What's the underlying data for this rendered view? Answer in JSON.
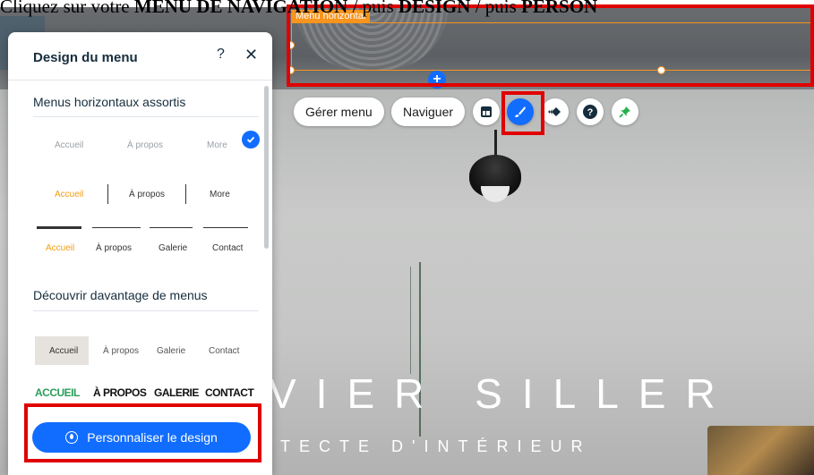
{
  "instruction": {
    "part1": "Cliquez sur votre ",
    "part2": "MENU DE NAVIGATION",
    "part3": " / puis ",
    "part4": "DESIGN",
    "part5": " / puis ",
    "part6": "PERSON"
  },
  "site": {
    "title": "VIER  SILLER",
    "subtitle": "ITECTE  D'INTÉRIEUR"
  },
  "editor": {
    "element_label": "Menu horizontal",
    "add_symbol": "+",
    "toolbar": {
      "manage_menu": "Gérer menu",
      "navigate": "Naviguer",
      "help_symbol": "?"
    }
  },
  "panel": {
    "title": "Design du menu",
    "help_symbol": "?",
    "close_symbol": "✕",
    "section1_title": "Menus horizontaux assortis",
    "section2_title": "Découvrir davantage de menus",
    "presets": [
      {
        "items": [
          "Accueil",
          "À propos",
          "More"
        ]
      },
      {
        "items": [
          "Accueil",
          "À propos",
          "More"
        ]
      },
      {
        "items": [
          "Accueil",
          "À propos",
          "Galerie",
          "Contact"
        ]
      },
      {
        "items": [
          "Accueil",
          "À propos",
          "Galerie",
          "Contact"
        ]
      },
      {
        "items": [
          "ACCUEIL",
          "À PROPOS",
          "GALERIE",
          "CONTACT"
        ]
      }
    ],
    "cta_label": "Personnaliser le design"
  },
  "colors": {
    "accent_blue": "#116dff",
    "selection_orange": "#f7941d",
    "highlight_red": "#e00000",
    "preset_orange": "#f39c12",
    "preset_green": "#2a9d58"
  }
}
